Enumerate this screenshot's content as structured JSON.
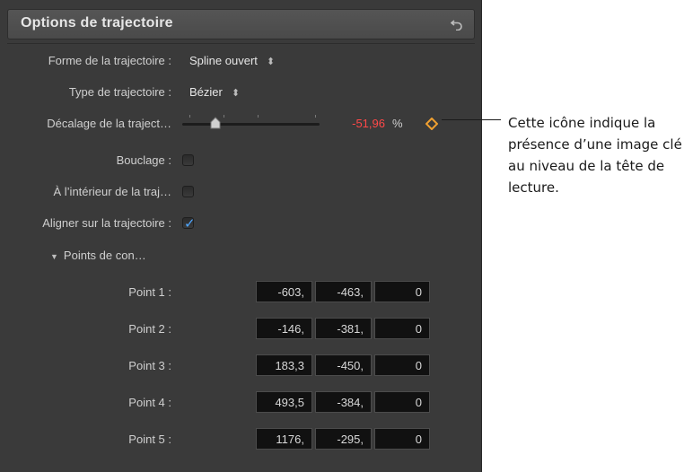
{
  "panel": {
    "title": "Options de trajectoire"
  },
  "rows": {
    "shape_label": "Forme de la trajectoire :",
    "shape_value": "Spline ouvert",
    "type_label": "Type de trajectoire :",
    "type_value": "Bézier",
    "offset_label": "Décalage de la traject…",
    "offset_value": "-51,96",
    "offset_unit": "%",
    "loop_label": "Bouclage :",
    "inside_label": "À l’intérieur de la traj…",
    "align_label": "Aligner sur la trajectoire :",
    "points_group_label": "Points de con…"
  },
  "checkboxes": {
    "loop": false,
    "inside": false,
    "align": true
  },
  "slider": {
    "offset_fraction": 0.24
  },
  "points": [
    {
      "label": "Point 1 :",
      "x": "-603,",
      "y": "-463,",
      "z": "0"
    },
    {
      "label": "Point 2 :",
      "x": "-146,",
      "y": "-381,",
      "z": "0"
    },
    {
      "label": "Point 3 :",
      "x": "183,3",
      "y": "-450,",
      "z": "0"
    },
    {
      "label": "Point 4 :",
      "x": "493,5",
      "y": "-384,",
      "z": "0"
    },
    {
      "label": "Point 5 :",
      "x": "1176,",
      "y": "-295,",
      "z": "0"
    }
  ],
  "annotation": {
    "text": "Cette icône indique la présence d’une image clé au niveau de la tête de lecture."
  },
  "icons": {
    "reset": "reset-arrow-icon",
    "keyframe": "keyframe-diamond-icon",
    "popup": "popup-arrows-icon",
    "disclosure": "disclosure-triangle-icon",
    "check": "checkmark-icon"
  },
  "colors": {
    "panel_bg": "#3a3a3a",
    "keyframe": "#f0a030",
    "value_red": "#ff4848",
    "check_blue": "#4ea6ff"
  }
}
